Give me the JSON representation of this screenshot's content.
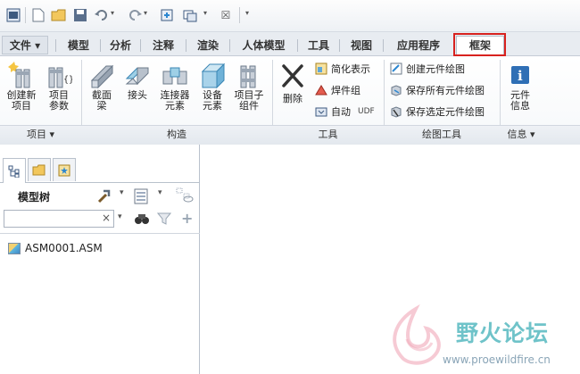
{
  "quick_access": {
    "icons": [
      "app-window-icon",
      "new-icon",
      "open-icon",
      "save-icon",
      "undo-icon",
      "redo-icon",
      "regenerate-icon",
      "windows-icon",
      "close-window-icon",
      "customize-icon"
    ]
  },
  "tabs": [
    {
      "label": "文件",
      "dropdown": "▾"
    },
    {
      "label": "模型"
    },
    {
      "label": "分析"
    },
    {
      "label": "注释"
    },
    {
      "label": "渲染"
    },
    {
      "label": "人体模型"
    },
    {
      "label": "工具"
    },
    {
      "label": "视图"
    },
    {
      "label": "应用程序"
    },
    {
      "label": "框架",
      "active": true
    }
  ],
  "ribbon": {
    "create_project": {
      "line1": "创建新",
      "line2": "项目"
    },
    "project_params": {
      "line1": "项目",
      "line2": "参数"
    },
    "section_beam": {
      "line1": "截面",
      "line2": "梁"
    },
    "joint": {
      "line1": "接头"
    },
    "connector_element": {
      "line1": "连接器",
      "line2": "元素"
    },
    "equipment_element": {
      "line1": "设备",
      "line2": "元素"
    },
    "project_sub_assembly": {
      "line1": "项目子",
      "line2": "组件"
    },
    "delete": {
      "line1": "删除"
    },
    "simplified_rep": "简化表示",
    "weld_group": "焊件组",
    "auto": "自动",
    "udf": "UDF",
    "create_drawing": "创建元件绘图",
    "save_all_drawings": "保存所有元件绘图",
    "save_selected_drawings": "保存选定元件绘图",
    "element_info": {
      "line1": "元件",
      "line2": "信息"
    },
    "groups": {
      "project": "项目",
      "construct": "构造",
      "tools": "工具",
      "drawing_tools": "绘图工具",
      "info": "信息",
      "dropdown": "▾"
    }
  },
  "model_tree": {
    "title": "模型树",
    "search_value": "",
    "clear": "×",
    "items": [
      {
        "label": "ASM0001.ASM"
      }
    ]
  },
  "watermark": {
    "title": "野火论坛",
    "url": "www.proewildfire.cn"
  },
  "colors": {
    "highlight": "#d8221f",
    "icon_blue": "#3d5a80",
    "watermark": "#6fc3c9"
  }
}
